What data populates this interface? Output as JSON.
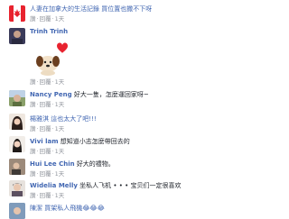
{
  "comments": [
    {
      "name": "",
      "text": "人妻在加拿大的生活記錄 買位置也撒不下呀",
      "like": "讚",
      "reply": "回覆",
      "time": "1天"
    },
    {
      "name": "Trinh Trinh",
      "text": "",
      "like": "讚",
      "reply": "回覆",
      "time": "1天"
    },
    {
      "name": "Nancy Peng",
      "text": "好大一隻，怎麼運回家呀~",
      "like": "讚",
      "reply": "回覆",
      "time": "1天"
    },
    {
      "name": "",
      "text": "楊雅淇 這也太大了吧!!!",
      "like": "讚",
      "reply": "回覆",
      "time": "1天"
    },
    {
      "name": "Vivi lam",
      "text": "想知道小志怎麼帶回去的",
      "like": "讚",
      "reply": "回覆",
      "time": "1天"
    },
    {
      "name": "Hui Lee Chin",
      "text": "好大的禮物。",
      "like": "讚",
      "reply": "回覆",
      "time": "1天"
    },
    {
      "name": "Widelia Melly",
      "text": "坐私人飞机 • • • 宝贝们一定很喜欢",
      "like": "讚",
      "reply": "回覆",
      "time": "1天"
    },
    {
      "name": "",
      "text": "陳潔 買架私人飛機😂😂😂",
      "like": "讚",
      "reply": "回覆",
      "time": "1天"
    }
  ],
  "sticker": {
    "name": "puppy-heart-sticker"
  },
  "colors": {
    "link": "#4267b2",
    "meta": "#90949c",
    "heart": "#e8232f"
  }
}
